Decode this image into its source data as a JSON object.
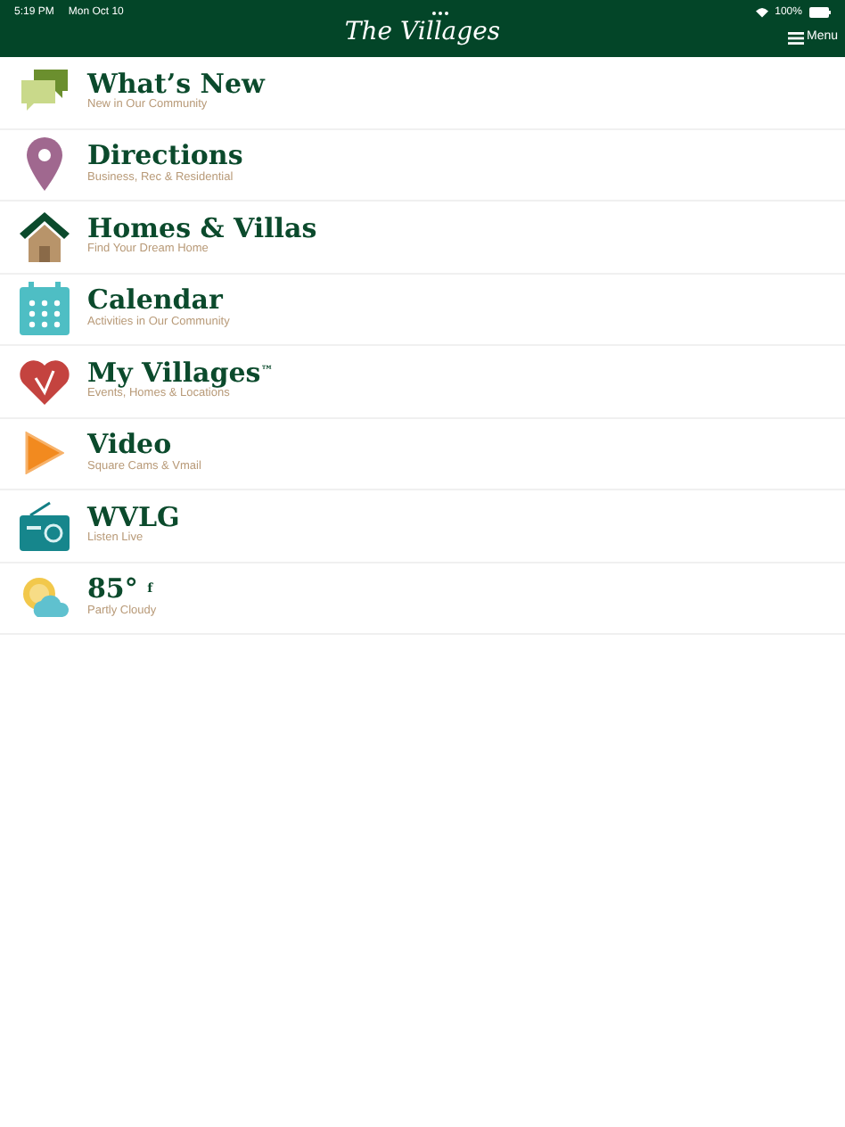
{
  "status_bar": {
    "time": "5:19 PM",
    "date": "Mon Oct 10",
    "battery": "100%"
  },
  "header": {
    "logo": "The Villages",
    "menu": "Menu"
  },
  "items": [
    {
      "kind": "chat",
      "title": "What’s New",
      "subtitle": "New in Our Community"
    },
    {
      "kind": "pin",
      "title": "Directions",
      "subtitle": "Business, Rec & Residential"
    },
    {
      "kind": "home",
      "title": "Homes & Villas",
      "subtitle": "Find Your Dream Home"
    },
    {
      "kind": "calendar",
      "title": "Calendar",
      "subtitle": "Activities in Our Community"
    },
    {
      "kind": "heart",
      "title": "My Villages$^{™}$",
      "subtitle": "Events, Homes & Locations"
    },
    {
      "kind": "play",
      "title": "Video",
      "subtitle": "Square Cams & Vmail"
    },
    {
      "kind": "radio",
      "title": "WVLG",
      "subtitle": "Listen Live"
    },
    {
      "kind": "weather",
      "title": "85° $^{f}$",
      "subtitle": "Partly Cloudy"
    }
  ]
}
